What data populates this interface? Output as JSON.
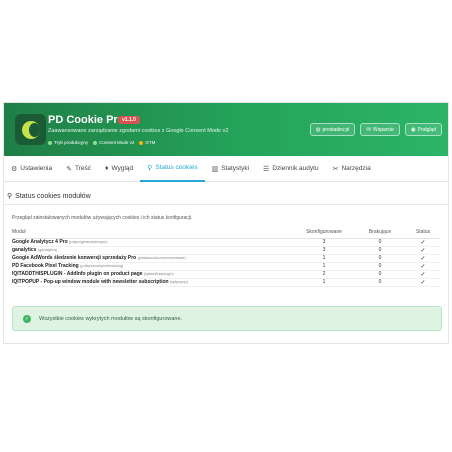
{
  "header": {
    "title": "PD Cookie Pro",
    "version": "v1.1.0",
    "subtitle": "Zaawansowane zarządzanie zgodami cookies z Google Consent Mode v2",
    "tags": [
      {
        "label": "Tryb produkcyjny",
        "color": "#8be28b"
      },
      {
        "label": "Consent Mode v2",
        "color": "#8be28b"
      },
      {
        "label": "GTM",
        "color": "#f5b400"
      }
    ],
    "buttons": {
      "prestadev": "prestadev.pl",
      "support": "Wsparcie",
      "preview": "Podgląd"
    }
  },
  "tabs": [
    {
      "label": "Ustawienia",
      "icon": "gear-icon"
    },
    {
      "label": "Treść",
      "icon": "edit-icon"
    },
    {
      "label": "Wygląd",
      "icon": "brush-icon"
    },
    {
      "label": "Status cookies",
      "icon": "search-icon",
      "active": true
    },
    {
      "label": "Statystyki",
      "icon": "bar-chart-icon"
    },
    {
      "label": "Dziennik audytu",
      "icon": "list-icon"
    },
    {
      "label": "Narzędzia",
      "icon": "wrench-icon"
    }
  ],
  "section": {
    "title": "Status cookies modułów",
    "description": "Przegląd zainstalowanych modułów używających cookies i ich status konfiguracji."
  },
  "table": {
    "headers": {
      "module": "Moduł",
      "configured": "Skonfigurowane",
      "missing": "Brakujące",
      "status": "Status"
    },
    "rows": [
      {
        "name": "Google Analytycz 4 Pro",
        "tech": "(pdgoogleanalyticspro)",
        "configured": "3",
        "missing": "0",
        "status": "✓"
      },
      {
        "name": "ganalytics",
        "tech": "(ganalytics)",
        "configured": "3",
        "missing": "0",
        "status": "✓"
      },
      {
        "name": "Google AdWords śledzenie konwersji sprzedaży Pro",
        "tech": "(pdadwordsconversiontrade)",
        "configured": "1",
        "missing": "0",
        "status": "✓"
      },
      {
        "name": "PD Facebook Pixel Tracking",
        "tech": "(pdfacebookpixeltracking)",
        "configured": "1",
        "missing": "0",
        "status": "✓"
      },
      {
        "name": "IQITADDTHISPLUGIN - AddInfo plugin on product page",
        "tech": "(iqitaddthisplugin)",
        "configured": "2",
        "missing": "0",
        "status": "✓"
      },
      {
        "name": "IQITPOPUP - Pop-up window module with newsletter subscription",
        "tech": "(iqitpopup)",
        "configured": "1",
        "missing": "0",
        "status": "✓"
      }
    ]
  },
  "alert": {
    "text": "Wszystkie cookies wykrytych modułów są skonfigurowane."
  }
}
